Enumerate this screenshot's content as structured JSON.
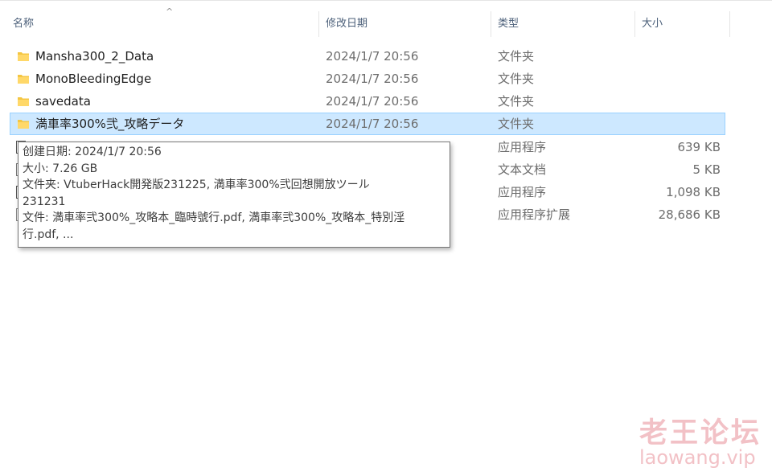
{
  "columns": {
    "name": "名称",
    "date": "修改日期",
    "type": "类型",
    "size": "大小",
    "sort_indicator": "^"
  },
  "rows": [
    {
      "name": "Mansha300_2_Data",
      "date": "2024/1/7 20:56",
      "type": "文件夹",
      "size": "",
      "icon": "folder-icon"
    },
    {
      "name": "MonoBleedingEdge",
      "date": "2024/1/7 20:56",
      "type": "文件夹",
      "size": "",
      "icon": "folder-icon"
    },
    {
      "name": "savedata",
      "date": "2024/1/7 20:56",
      "type": "文件夹",
      "size": "",
      "icon": "folder-icon"
    },
    {
      "name": "満車率300%弐_攻略データ",
      "date": "2024/1/7 20:56",
      "type": "文件夹",
      "size": "",
      "icon": "folder-icon",
      "selected": true
    },
    {
      "name": "",
      "date": "",
      "type": "应用程序",
      "size": "639 KB",
      "icon": "app-icon"
    },
    {
      "name": "",
      "date": "",
      "type": "文本文档",
      "size": "5 KB",
      "icon": "text-file-icon"
    },
    {
      "name": "",
      "date": "",
      "type": "应用程序",
      "size": "1,098 KB",
      "icon": "app-icon"
    },
    {
      "name": "",
      "date": "",
      "type": "应用程序扩展",
      "size": "28,686 KB",
      "icon": "dll-icon"
    }
  ],
  "tooltip": {
    "line1": "创建日期: 2024/1/7 20:56",
    "line2": "大小: 7.26 GB",
    "line3": "文件夹: VtuberHack開発版231225, 満車率300%弐回想開放ツール",
    "line4": "231231",
    "line5": "文件: 満車率弐300%_攻略本_臨時號行.pdf, 満車率弐300%_攻略本_特別淫",
    "line6": "行.pdf, ..."
  },
  "watermark": {
    "cn": "老王论坛",
    "en": "laowang.vip"
  },
  "colors": {
    "selection_bg": "#cde8ff",
    "selection_border": "#99d1ff",
    "folder": "#f4c642",
    "header_text": "#4c607a",
    "watermark": "#f2c1c6"
  }
}
